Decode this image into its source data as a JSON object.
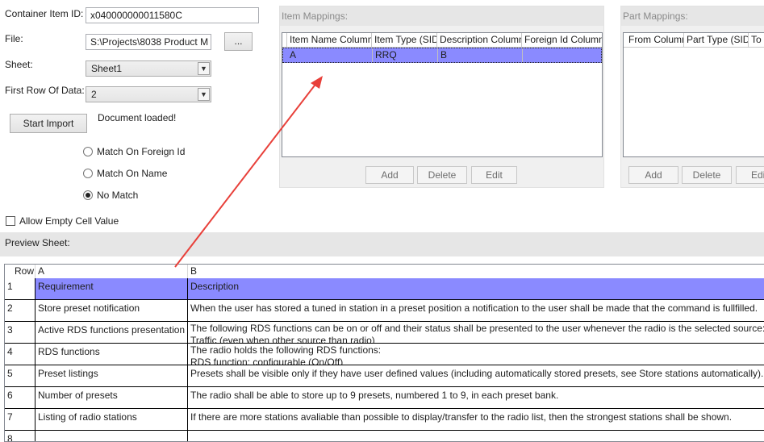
{
  "form": {
    "container_label": "Container Item ID:",
    "container_value": "x040000000011580C",
    "file_label": "File:",
    "file_value": "S:\\Projects\\8038 Product M",
    "browse_label": "...",
    "sheet_label": "Sheet:",
    "sheet_value": "Sheet1",
    "first_row_label": "First Row Of Data:",
    "first_row_value": "2",
    "start_import_label": "Start Import",
    "status_text": "Document loaded!",
    "radio_foreign": "Match On Foreign Id",
    "radio_name": "Match On Name",
    "radio_none": "No Match",
    "selected_radio": "No Match",
    "allow_empty_label": "Allow Empty Cell Value",
    "allow_empty_checked": false
  },
  "item_mappings": {
    "title": "Item Mappings:",
    "columns": [
      "Item Name Column",
      "Item Type (SID)",
      "Description Column",
      "Foreign Id Column"
    ],
    "rows": [
      [
        "A",
        "RRQ",
        "B",
        ""
      ]
    ],
    "add_label": "Add",
    "delete_label": "Delete",
    "edit_label": "Edit"
  },
  "part_mappings": {
    "title": "Part Mappings:",
    "columns": [
      "From Column",
      "Part Type (SID)",
      "To C"
    ],
    "add_label": "Add",
    "delete_label": "Delete",
    "edit_label": "Edi"
  },
  "preview": {
    "title": "Preview Sheet:",
    "headers": [
      "Row",
      "A",
      "B"
    ],
    "rows": [
      {
        "n": "1",
        "a": "Requirement",
        "b": "Description",
        "b2": ""
      },
      {
        "n": "2",
        "a": "Store preset notification",
        "b": "When the user has stored a tuned in station in a preset position a notification to the user shall be made that the command is fullfilled.",
        "b2": ""
      },
      {
        "n": "3",
        "a": "Active RDS functions presentation",
        "b": "The following RDS functions can be on or off and their status shall be presented to the user whenever the radio is the selected source:",
        "b2": "Traffic (even when other source than radio)"
      },
      {
        "n": "4",
        "a": "RDS functions",
        "b": "The radio holds the following RDS functions:",
        "b2": "RDS function: configurable (On/Off)"
      },
      {
        "n": "5",
        "a": "Preset listings",
        "b": "Presets shall be visible only if they have user defined values (including automatically stored presets, see Store stations automatically).",
        "b2": ""
      },
      {
        "n": "6",
        "a": "Number of presets",
        "b": "The radio shall be able to store up to 9 presets, numbered 1 to 9, in each preset bank.",
        "b2": ""
      },
      {
        "n": "7",
        "a": "Listing of radio stations",
        "b": "If there are more stations avaliable than possible to display/transfer to the radio list, then the strongest stations shall be shown.",
        "b2": ""
      },
      {
        "n": "8",
        "a": "",
        "b": "",
        "b2": ""
      }
    ]
  },
  "colors": {
    "selection": "#8a8aff",
    "arrow": "#e8403a"
  }
}
